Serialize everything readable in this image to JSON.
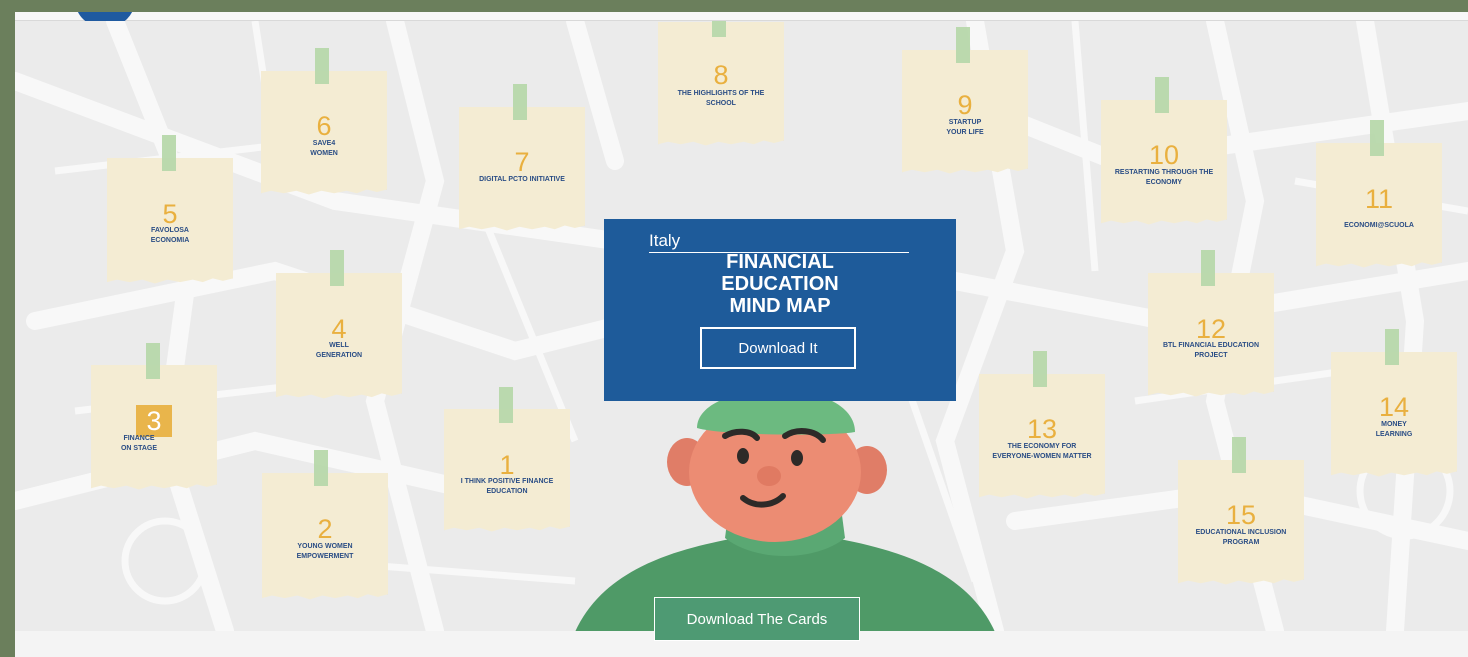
{
  "panel": {
    "country": "Italy",
    "title_lines": [
      "FINANCIAL",
      "EDUCATION",
      "MIND MAP"
    ],
    "download_label": "Download It"
  },
  "cards_button_label": "Download The Cards",
  "notes": [
    {
      "num": "1",
      "label": "I THINK POSITIVE FINANCE\nEDUCATION"
    },
    {
      "num": "2",
      "label": "YOUNG WOMEN\nEMPOWERMENT"
    },
    {
      "num": "3",
      "label": "FINANCE\nON STAGE"
    },
    {
      "num": "4",
      "label": "WELL\nGENERATION"
    },
    {
      "num": "5",
      "label": "FAVOLOSA\nECONOMIA"
    },
    {
      "num": "6",
      "label": "SAVE4\nWOMEN"
    },
    {
      "num": "7",
      "label": "DIGITAL PCTO INITIATIVE"
    },
    {
      "num": "8",
      "label": "THE HIGHLIGHTS OF THE\nSCHOOL"
    },
    {
      "num": "9",
      "label": "STARTUP\nYOUR LIFE"
    },
    {
      "num": "10",
      "label": "RESTARTING THROUGH THE\nECONOMY"
    },
    {
      "num": "11",
      "label": "ECONOMI@SCUOLA"
    },
    {
      "num": "12",
      "label": "BTL FINANCIAL EDUCATION\nPROJECT"
    },
    {
      "num": "13",
      "label": "THE ECONOMY FOR\nEVERYONE-WOMEN MATTER"
    },
    {
      "num": "14",
      "label": "MONEY\nLEARNING"
    },
    {
      "num": "15",
      "label": "EDUCATIONAL INCLUSION\nPROGRAM"
    }
  ],
  "colors": {
    "panel": "#1e5b9a",
    "note": "#f4ecd3",
    "tape": "#b7d8ab",
    "number": "#e9b03f",
    "label": "#2a4d85",
    "cards_button": "#4e9a73"
  }
}
